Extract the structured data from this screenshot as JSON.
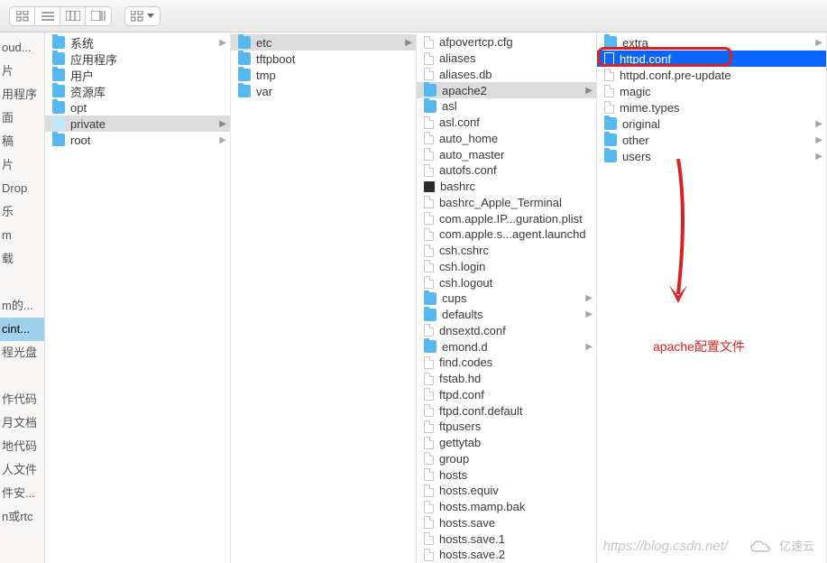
{
  "toolbar": {
    "view_modes": [
      "icon-view",
      "list-view",
      "column-view",
      "gallery-view"
    ],
    "active_mode_index": 2,
    "arrange_chevron": "down"
  },
  "sidebar": {
    "items": [
      {
        "label": "oud..."
      },
      {
        "label": "片"
      },
      {
        "label": "用程序"
      },
      {
        "label": "面"
      },
      {
        "label": "稿"
      },
      {
        "label": "片"
      },
      {
        "label": "Drop"
      },
      {
        "label": "乐"
      },
      {
        "label": "m"
      },
      {
        "label": "载"
      },
      {
        "label": ""
      },
      {
        "label": "m的..."
      },
      {
        "label": "cint...",
        "selected": true
      },
      {
        "label": "程光盘"
      },
      {
        "label": ""
      },
      {
        "label": "作代码"
      },
      {
        "label": "月文档"
      },
      {
        "label": "地代码"
      },
      {
        "label": "人文件"
      },
      {
        "label": "件安..."
      },
      {
        "label": "n或rtc"
      },
      {
        "label": ""
      }
    ]
  },
  "col1": [
    {
      "name": "系统",
      "type": "folder",
      "has_children": true
    },
    {
      "name": "应用程序",
      "type": "folder"
    },
    {
      "name": "用户",
      "type": "folder"
    },
    {
      "name": "资源库",
      "type": "folder"
    },
    {
      "name": "opt",
      "type": "folder"
    },
    {
      "name": "private",
      "type": "folder-light",
      "has_children": true,
      "selected": "grey"
    },
    {
      "name": "root",
      "type": "folder",
      "has_children": true
    }
  ],
  "col2": [
    {
      "name": "etc",
      "type": "folder",
      "has_children": true,
      "selected": "grey"
    },
    {
      "name": "tftpboot",
      "type": "folder"
    },
    {
      "name": "tmp",
      "type": "folder"
    },
    {
      "name": "var",
      "type": "folder"
    }
  ],
  "col3": [
    {
      "name": "afpovertcp.cfg",
      "type": "file"
    },
    {
      "name": "aliases",
      "type": "file"
    },
    {
      "name": "aliases.db",
      "type": "file"
    },
    {
      "name": "apache2",
      "type": "folder",
      "has_children": true,
      "selected": "grey"
    },
    {
      "name": "asl",
      "type": "folder"
    },
    {
      "name": "asl.conf",
      "type": "file"
    },
    {
      "name": "auto_home",
      "type": "file"
    },
    {
      "name": "auto_master",
      "type": "file"
    },
    {
      "name": "autofs.conf",
      "type": "file"
    },
    {
      "name": "bashrc",
      "type": "file-dark"
    },
    {
      "name": "bashrc_Apple_Terminal",
      "type": "file"
    },
    {
      "name": "com.apple.IP...guration.plist",
      "type": "file"
    },
    {
      "name": "com.apple.s...agent.launchd",
      "type": "file"
    },
    {
      "name": "csh.cshrc",
      "type": "file"
    },
    {
      "name": "csh.login",
      "type": "file"
    },
    {
      "name": "csh.logout",
      "type": "file"
    },
    {
      "name": "cups",
      "type": "folder",
      "has_children": true
    },
    {
      "name": "defaults",
      "type": "folder",
      "has_children": true
    },
    {
      "name": "dnsextd.conf",
      "type": "file"
    },
    {
      "name": "emond.d",
      "type": "folder",
      "has_children": true
    },
    {
      "name": "find.codes",
      "type": "file"
    },
    {
      "name": "fstab.hd",
      "type": "file"
    },
    {
      "name": "ftpd.conf",
      "type": "file"
    },
    {
      "name": "ftpd.conf.default",
      "type": "file"
    },
    {
      "name": "ftpusers",
      "type": "file"
    },
    {
      "name": "gettytab",
      "type": "file"
    },
    {
      "name": "group",
      "type": "file"
    },
    {
      "name": "hosts",
      "type": "file"
    },
    {
      "name": "hosts.equiv",
      "type": "file"
    },
    {
      "name": "hosts.mamp.bak",
      "type": "file"
    },
    {
      "name": "hosts.save",
      "type": "file"
    },
    {
      "name": "hosts.save.1",
      "type": "file"
    },
    {
      "name": "hosts.save.2",
      "type": "file"
    }
  ],
  "col4": [
    {
      "name": "extra",
      "type": "folder",
      "has_children": true
    },
    {
      "name": "httpd.conf",
      "type": "file",
      "selected": "blue"
    },
    {
      "name": "httpd.conf.pre-update",
      "type": "file"
    },
    {
      "name": "magic",
      "type": "file"
    },
    {
      "name": "mime.types",
      "type": "file"
    },
    {
      "name": "original",
      "type": "folder",
      "has_children": true
    },
    {
      "name": "other",
      "type": "folder",
      "has_children": true
    },
    {
      "name": "users",
      "type": "folder",
      "has_children": true
    }
  ],
  "annotation": {
    "label": "apache配置文件"
  },
  "watermark": {
    "url": "https://blog.csdn.net/",
    "brand": "亿速云"
  }
}
